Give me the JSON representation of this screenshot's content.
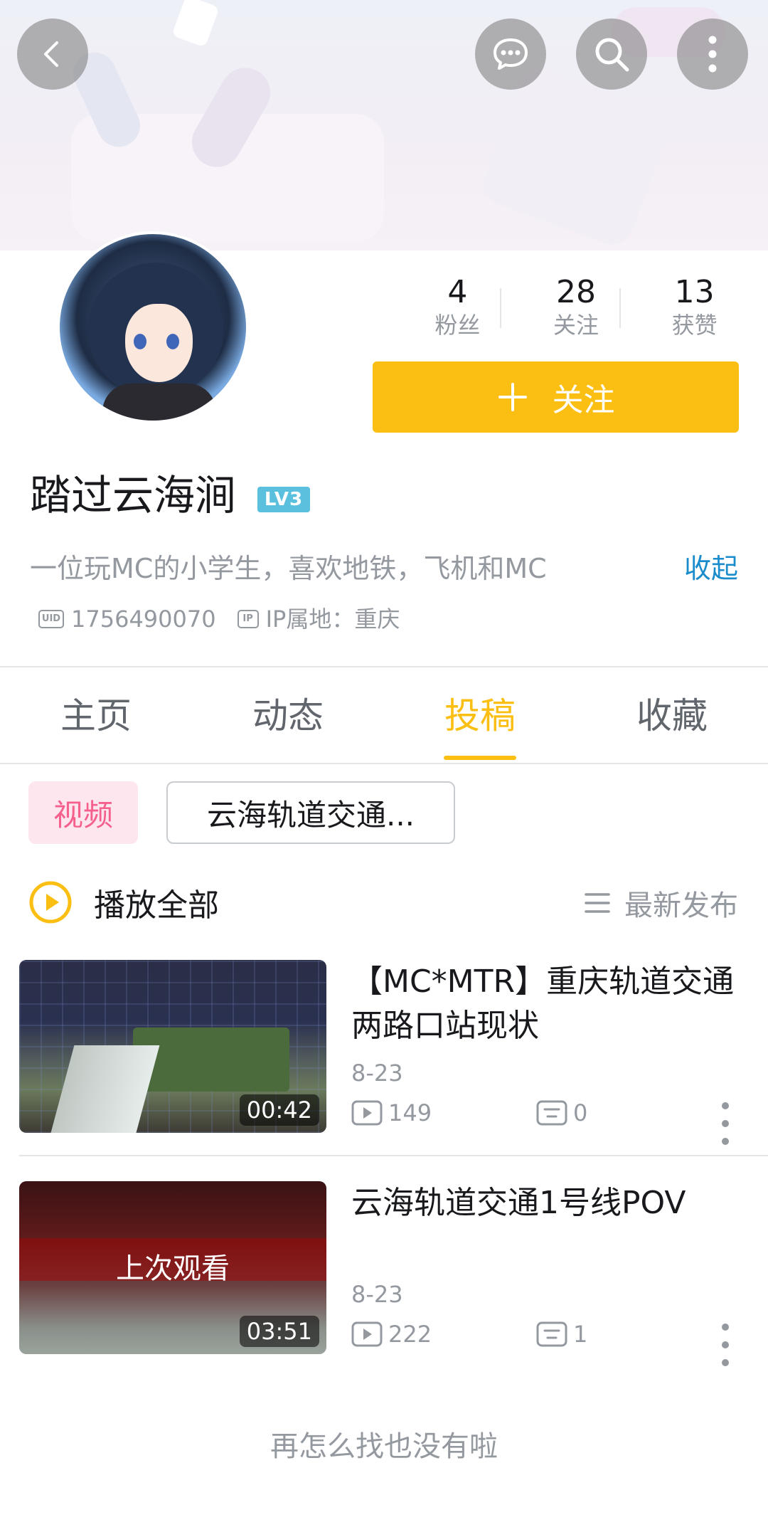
{
  "header": {
    "back_icon": "back-arrow-icon",
    "message_icon": "message-bubble-icon",
    "search_icon": "search-icon",
    "more_icon": "more-vertical-icon"
  },
  "profile": {
    "stats": [
      {
        "value": "4",
        "label": "粉丝"
      },
      {
        "value": "28",
        "label": "关注"
      },
      {
        "value": "13",
        "label": "获赞"
      }
    ],
    "follow_button": {
      "icon": "plus-icon",
      "label": "关注"
    },
    "username": "踏过云海涧",
    "level": "LV3",
    "bio": "一位玩MC的小学生，喜欢地铁，飞机和MC",
    "collapse_label": "收起",
    "uid_tag": "UID",
    "uid": "1756490070",
    "ip_tag": "IP",
    "ip_location": "IP属地：重庆"
  },
  "tabs": [
    {
      "label": "主页",
      "active": false
    },
    {
      "label": "动态",
      "active": false
    },
    {
      "label": "投稿",
      "active": true
    },
    {
      "label": "收藏",
      "active": false
    }
  ],
  "filters": {
    "video_chip": "视频",
    "collection_chip": "云海轨道交通..."
  },
  "toolbar": {
    "play_all": "播放全部",
    "sort": "最新发布"
  },
  "videos": [
    {
      "title": "【MC*MTR】重庆轨道交通两路口站现状",
      "date": "8-23",
      "duration": "00:42",
      "views": "149",
      "comments": "0",
      "overlay": ""
    },
    {
      "title": "云海轨道交通1号线POV",
      "date": "8-23",
      "duration": "03:51",
      "views": "222",
      "comments": "1",
      "overlay": "上次观看"
    }
  ],
  "footer": {
    "end_text": "再怎么找也没有啦"
  },
  "colors": {
    "accent": "#fbbf14",
    "link": "#1a8ccc",
    "pink": "#f5608d",
    "muted": "#9499a0"
  }
}
